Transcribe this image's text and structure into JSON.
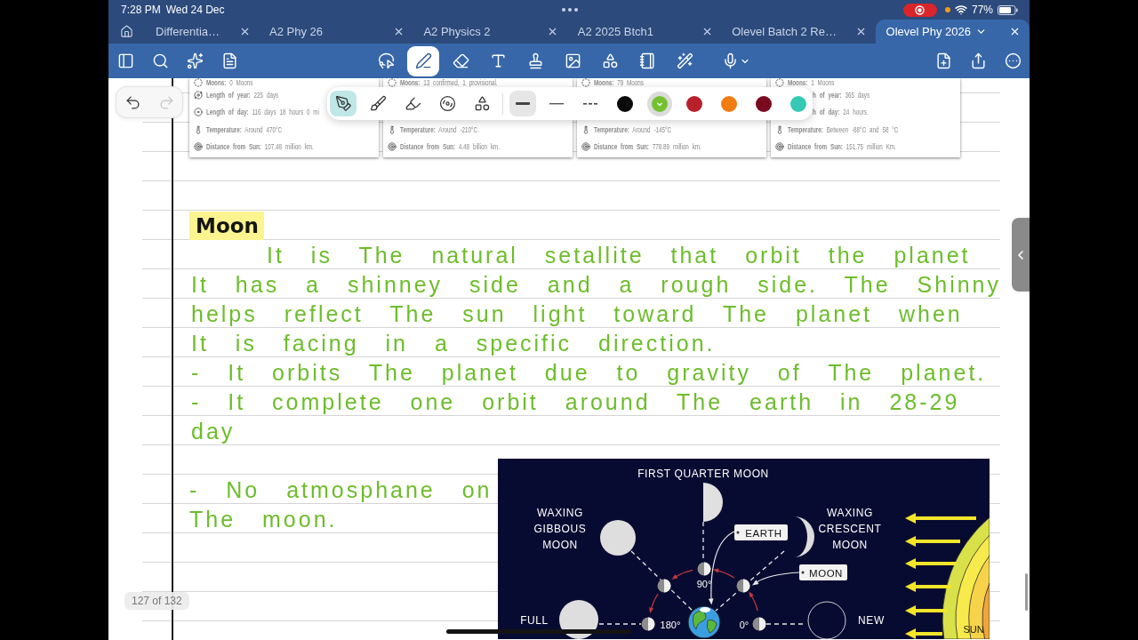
{
  "status_bar": {
    "time": "7:28 PM",
    "date": "Wed 24 Dec",
    "battery": "77%"
  },
  "tabs": [
    {
      "label": "Differentia…",
      "selected": false
    },
    {
      "label": "A2 Phy 26",
      "selected": false
    },
    {
      "label": "A2 Physics 2",
      "selected": false
    },
    {
      "label": "A2 2025 Btch1",
      "selected": false
    },
    {
      "label": "Olevel Batch 2 Re…",
      "selected": false
    },
    {
      "label": "Olevel Phy 2026",
      "selected": true
    }
  ],
  "toolbar": {
    "tools": [
      {
        "selected": false
      },
      {
        "selected": true
      },
      {
        "selected": false
      },
      {
        "selected": false
      },
      {
        "selected": false
      },
      {
        "selected": false
      },
      {
        "selected": false
      },
      {
        "selected": false
      },
      {
        "selected": false
      }
    ]
  },
  "undo": {
    "disabled": false
  },
  "redo": {
    "disabled": true
  },
  "pen_popup": {
    "tools": [
      {
        "selected": true
      },
      {
        "selected": false
      },
      {
        "selected": false
      },
      {
        "selected": false
      },
      {
        "selected": false
      }
    ],
    "strokes": [
      {
        "selected": true
      },
      {
        "selected": false
      },
      {
        "selected": false
      }
    ],
    "colors": [
      {
        "color": "#0b0b0b",
        "selected": false
      },
      {
        "color": "#74c12f",
        "selected": true
      },
      {
        "color": "#b8202c",
        "selected": false
      },
      {
        "color": "#f07c12",
        "selected": false
      },
      {
        "color": "#7a0a1e",
        "selected": false
      },
      {
        "color": "#35c9b5",
        "selected": false
      }
    ]
  },
  "planet_cards": [
    {
      "rows": [
        {
          "kind": "moons",
          "text": "**Moons:** 0 Moons"
        },
        {
          "kind": "year",
          "text": "**Length of year:** 225 days"
        },
        {
          "kind": "day",
          "text": "**Length of day:** 116 days 18 hours 0 mi"
        },
        {
          "kind": "temperature",
          "text": "**Temperature:** Around 470°C"
        },
        {
          "kind": "distance",
          "text": "**Distance from Sun:** 107.48 million km."
        }
      ]
    },
    {
      "rows": [
        {
          "kind": "moons",
          "text": "**Moons:** 13 confirmed, 1 provisional."
        },
        {
          "kind": "temperature",
          "text": "**Temperature:** Around -210°C."
        },
        {
          "kind": "distance",
          "text": "**Distance from Sun:** 4.48 billion km."
        }
      ]
    },
    {
      "rows": [
        {
          "kind": "moons",
          "text": "**Moons:** 79 Moons"
        },
        {
          "kind": "temperature",
          "text": "**Temperature:** Around -145°C"
        },
        {
          "kind": "distance",
          "text": "**Distance from Sun:** 778.89 million km."
        }
      ]
    },
    {
      "rows": [
        {
          "kind": "moons",
          "text": "**Moons:** 1 Moons"
        },
        {
          "kind": "year",
          "text": "**h of year:** 365 days"
        },
        {
          "kind": "day",
          "text": "**h of day:** 24 hours."
        },
        {
          "kind": "temperature",
          "text": "**Temperature:** Between -88°C and 58 °C"
        },
        {
          "kind": "distance",
          "text": "**Distance from Sun:** 151.75 million Km."
        }
      ]
    }
  ],
  "note": {
    "title": "Moon",
    "lines": [
      "It is The natural setallite that orbit the planet",
      "It has a shinney side and a rough side. The Shinny",
      "helps reflect The sun light toward The planet when",
      "It is facing in a specific direction.",
      "- It orbits The planet due to gravity of The planet.",
      "- It complete one orbit around The earth in 28-29",
      "day"
    ],
    "side_lines": [
      "- No atmosphane on",
      "The moon."
    ]
  },
  "diagram": {
    "labels": {
      "first_quarter": "FIRST QUARTER MOON",
      "waxing_gibbous": "WAXING GIBBOUS MOON",
      "waxing_crescent": "WAXING CRESCENT MOON",
      "full": "FULL",
      "new": "NEW"
    },
    "tags": [
      "EARTH",
      "MOON"
    ],
    "angles": [
      "90°",
      "180°",
      "0°"
    ],
    "sun": "SUN"
  },
  "page_counter": "127 of 132"
}
